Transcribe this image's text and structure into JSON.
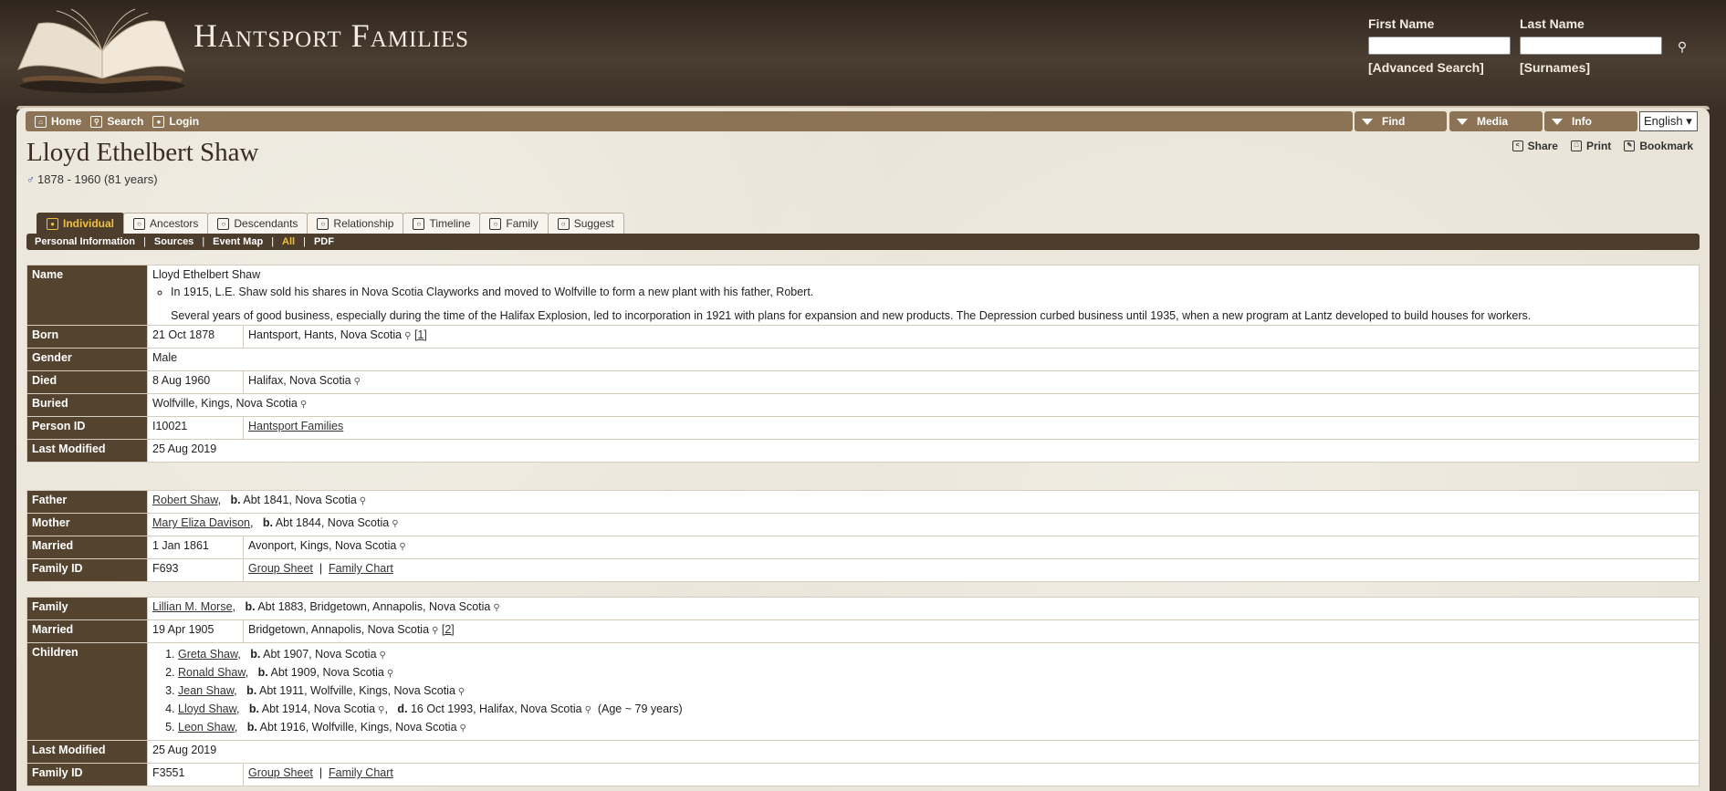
{
  "site": {
    "title": "Hantsport Families"
  },
  "search": {
    "first_label": "First Name",
    "last_label": "Last Name",
    "advanced": "[Advanced Search]",
    "surnames": "[Surnames]"
  },
  "menu": {
    "home": "Home",
    "search": "Search",
    "login": "Login",
    "find": "Find",
    "media": "Media",
    "info": "Info",
    "language": "English"
  },
  "person": {
    "name": "Lloyd Ethelbert Shaw",
    "lifespan": "1878 - 1960  (81 years)",
    "actions": {
      "share": "Share",
      "print": "Print",
      "bookmark": "Bookmark"
    }
  },
  "tabs": [
    "Individual",
    "Ancestors",
    "Descendants",
    "Relationship",
    "Timeline",
    "Family",
    "Suggest"
  ],
  "subnav": [
    "Personal Information",
    "Sources",
    "Event Map",
    "All",
    "PDF"
  ],
  "individual": {
    "name_label": "Name",
    "name_value": "Lloyd Ethelbert Shaw",
    "note1": "In 1915, L.E. Shaw sold his shares in Nova Scotia Clayworks and moved to Wolfville to form a new plant with his father, Robert.",
    "note2": "Several years of good business, especially during the time of the Halifax Explosion, led to incorporation in 1921 with plans for expansion and new products. The Depression curbed business until 1935, when a new program at Lantz developed to build houses for workers.",
    "born_label": "Born",
    "born_date": "21 Oct 1878",
    "born_place": "Hantsport, Hants, Nova Scotia",
    "born_src": "[1]",
    "gender_label": "Gender",
    "gender": "Male",
    "died_label": "Died",
    "died_date": "8 Aug 1960",
    "died_place": "Halifax, Nova Scotia",
    "buried_label": "Buried",
    "buried_place": "Wolfville, Kings, Nova Scotia",
    "pid_label": "Person ID",
    "pid": "I10021",
    "pid_tree": "Hantsport Families",
    "mod_label": "Last Modified",
    "mod_date": "25 Aug 2019"
  },
  "parents": {
    "father_label": "Father",
    "father": "Robert Shaw",
    "father_b": "b.",
    "father_info": "Abt 1841, Nova Scotia",
    "mother_label": "Mother",
    "mother": "Mary Eliza Davison",
    "mother_b": "b.",
    "mother_info": "Abt 1844, Nova Scotia",
    "married_label": "Married",
    "married_date": "1 Jan 1861",
    "married_place": "Avonport, Kings, Nova Scotia",
    "fid_label": "Family ID",
    "fid": "F693",
    "group_sheet": "Group Sheet",
    "family_chart": "Family Chart"
  },
  "family": {
    "family_label": "Family",
    "spouse": "Lillian M. Morse",
    "spouse_b": "b.",
    "spouse_info": "Abt 1883, Bridgetown, Annapolis, Nova Scotia",
    "married_label": "Married",
    "married_date": "19 Apr 1905",
    "married_place": "Bridgetown, Annapolis, Nova Scotia",
    "married_src": "[2]",
    "children_label": "Children",
    "children": [
      {
        "name": "Greta Shaw",
        "b": "b.",
        "info": "Abt 1907, Nova Scotia"
      },
      {
        "name": "Ronald Shaw",
        "b": "b.",
        "info": "Abt 1909, Nova Scotia"
      },
      {
        "name": "Jean Shaw",
        "b": "b.",
        "info": "Abt 1911, Wolfville, Kings, Nova Scotia"
      },
      {
        "name": "Lloyd Shaw",
        "b": "b.",
        "info": "Abt 1914, Nova Scotia",
        "d": "d.",
        "dinfo": "16 Oct 1993, Halifax, Nova Scotia",
        "age": "(Age ~ 79 years)"
      },
      {
        "name": "Leon Shaw",
        "b": "b.",
        "info": "Abt 1916, Wolfville, Kings, Nova Scotia"
      }
    ],
    "mod_label": "Last Modified",
    "mod_date": "25 Aug 2019",
    "fid_label": "Family ID",
    "fid": "F3551",
    "group_sheet": "Group Sheet",
    "family_chart": "Family Chart"
  }
}
